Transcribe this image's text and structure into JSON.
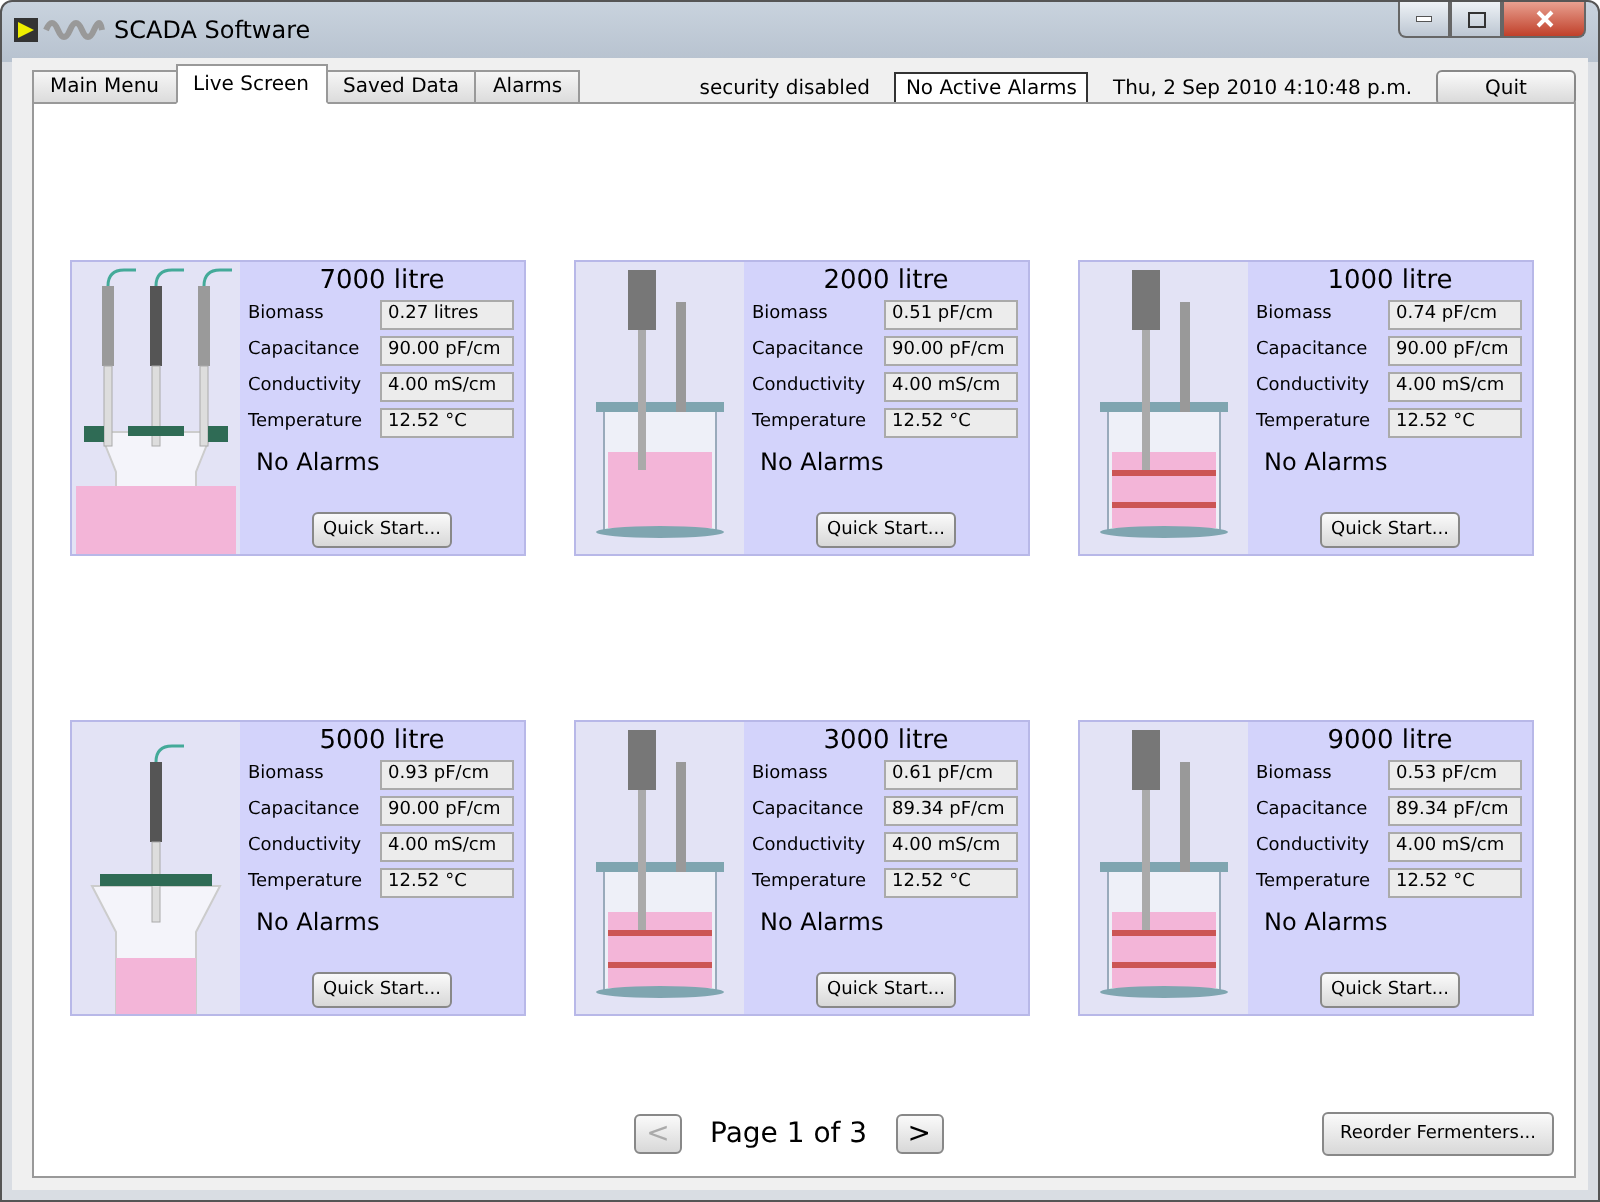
{
  "window": {
    "title": "SCADA Software"
  },
  "tabs": [
    {
      "label": "Main Menu",
      "selected": false
    },
    {
      "label": "Live Screen",
      "selected": true
    },
    {
      "label": "Saved Data",
      "selected": false
    },
    {
      "label": "Alarms",
      "selected": false
    }
  ],
  "header": {
    "security": "security disabled",
    "alarm_status": "No Active Alarms",
    "datetime": "Thu, 2 Sep 2010  4:10:48 p.m.",
    "quit_button": "Quit"
  },
  "fermenters": [
    {
      "title": "7000 litre",
      "kind": "multi_probe",
      "readings": [
        {
          "label": "Biomass",
          "value": "0.27 litres"
        },
        {
          "label": "Capacitance",
          "value": "90.00 pF/cm"
        },
        {
          "label": "Conductivity",
          "value": "4.00 mS/cm"
        },
        {
          "label": "Temperature",
          "value": "12.52 °C"
        }
      ],
      "alarm": "No Alarms",
      "button": "Quick Start..."
    },
    {
      "title": "2000 litre",
      "kind": "stirred",
      "readings": [
        {
          "label": "Biomass",
          "value": "0.51 pF/cm"
        },
        {
          "label": "Capacitance",
          "value": "90.00 pF/cm"
        },
        {
          "label": "Conductivity",
          "value": "4.00 mS/cm"
        },
        {
          "label": "Temperature",
          "value": "12.52 °C"
        }
      ],
      "alarm": "No Alarms",
      "button": "Quick Start..."
    },
    {
      "title": "1000 litre",
      "kind": "banded",
      "readings": [
        {
          "label": "Biomass",
          "value": "0.74 pF/cm"
        },
        {
          "label": "Capacitance",
          "value": "90.00 pF/cm"
        },
        {
          "label": "Conductivity",
          "value": "4.00 mS/cm"
        },
        {
          "label": "Temperature",
          "value": "12.52 °C"
        }
      ],
      "alarm": "No Alarms",
      "button": "Quick Start..."
    },
    {
      "title": "5000 litre",
      "kind": "single_probe",
      "readings": [
        {
          "label": "Biomass",
          "value": "0.93 pF/cm"
        },
        {
          "label": "Capacitance",
          "value": "90.00 pF/cm"
        },
        {
          "label": "Conductivity",
          "value": "4.00 mS/cm"
        },
        {
          "label": "Temperature",
          "value": "12.52 °C"
        }
      ],
      "alarm": "No Alarms",
      "button": "Quick Start..."
    },
    {
      "title": "3000 litre",
      "kind": "banded",
      "readings": [
        {
          "label": "Biomass",
          "value": "0.61 pF/cm"
        },
        {
          "label": "Capacitance",
          "value": "89.34 pF/cm"
        },
        {
          "label": "Conductivity",
          "value": "4.00 mS/cm"
        },
        {
          "label": "Temperature",
          "value": "12.52 °C"
        }
      ],
      "alarm": "No Alarms",
      "button": "Quick Start..."
    },
    {
      "title": "9000 litre",
      "kind": "banded",
      "readings": [
        {
          "label": "Biomass",
          "value": "0.53 pF/cm"
        },
        {
          "label": "Capacitance",
          "value": "89.34 pF/cm"
        },
        {
          "label": "Conductivity",
          "value": "4.00 mS/cm"
        },
        {
          "label": "Temperature",
          "value": "12.52 °C"
        }
      ],
      "alarm": "No Alarms",
      "button": "Quick Start..."
    }
  ],
  "pager": {
    "prev": {
      "label": "<",
      "disabled": true
    },
    "page": "Page 1 of 3",
    "next": {
      "label": ">",
      "disabled": false
    },
    "reorder_button": "Reorder Fermenters..."
  }
}
